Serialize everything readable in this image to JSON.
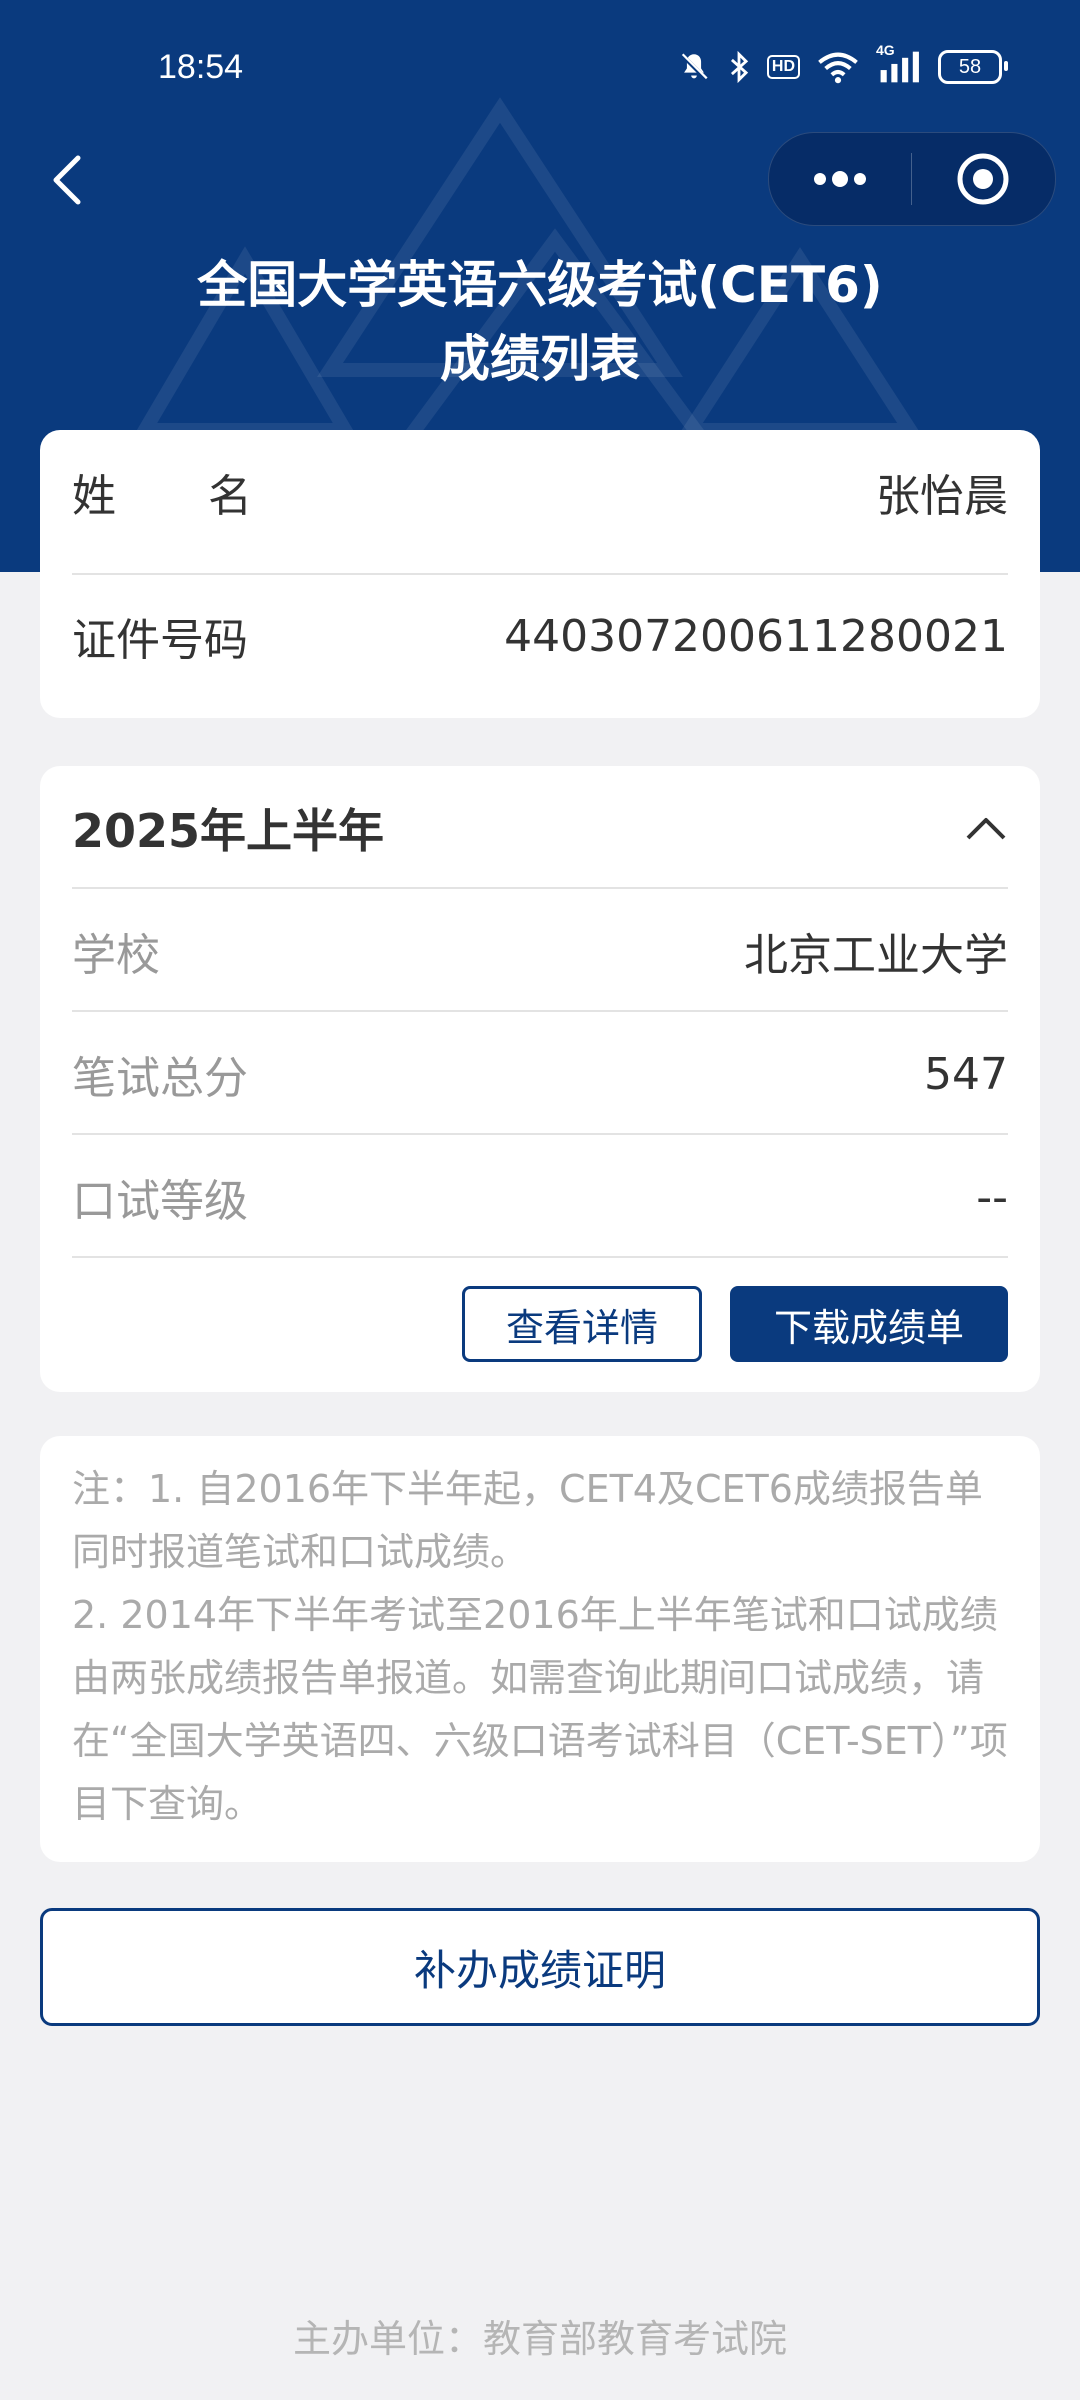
{
  "status_bar": {
    "time": "18:54",
    "network": "4G",
    "hd": "HD",
    "battery": "58"
  },
  "nav": {
    "title_line1": "全国大学英语六级考试(CET6)",
    "title_line2": "成绩列表"
  },
  "personal": {
    "name_label_1": "姓",
    "name_label_2": "名",
    "name_value": "张怡晨",
    "id_label": "证件号码",
    "id_value": "440307200611280021"
  },
  "result": {
    "period": "2025年上半年",
    "school_label": "学校",
    "school_value": "北京工业大学",
    "written_label": "笔试总分",
    "written_value": "547",
    "oral_label": "口试等级",
    "oral_value": "--",
    "details_button": "查看详情",
    "download_button": "下载成绩单"
  },
  "notes": {
    "line1": "注：1. 自2016年下半年起，CET4及CET6成绩报告单同时报道笔试和口试成绩。",
    "line2": "2. 2014年下半年考试至2016年上半年笔试和口试成绩由两张成绩报告单报道。如需查询此期间口试成绩，请在“全国大学英语四、六级口语考试科目（CET-SET）”项目下查询。"
  },
  "supplement_button": "补办成绩证明",
  "footer": "主办单位：教育部教育考试院",
  "colors": {
    "brand": "#0a3a7e",
    "background": "#f1f1f3"
  }
}
